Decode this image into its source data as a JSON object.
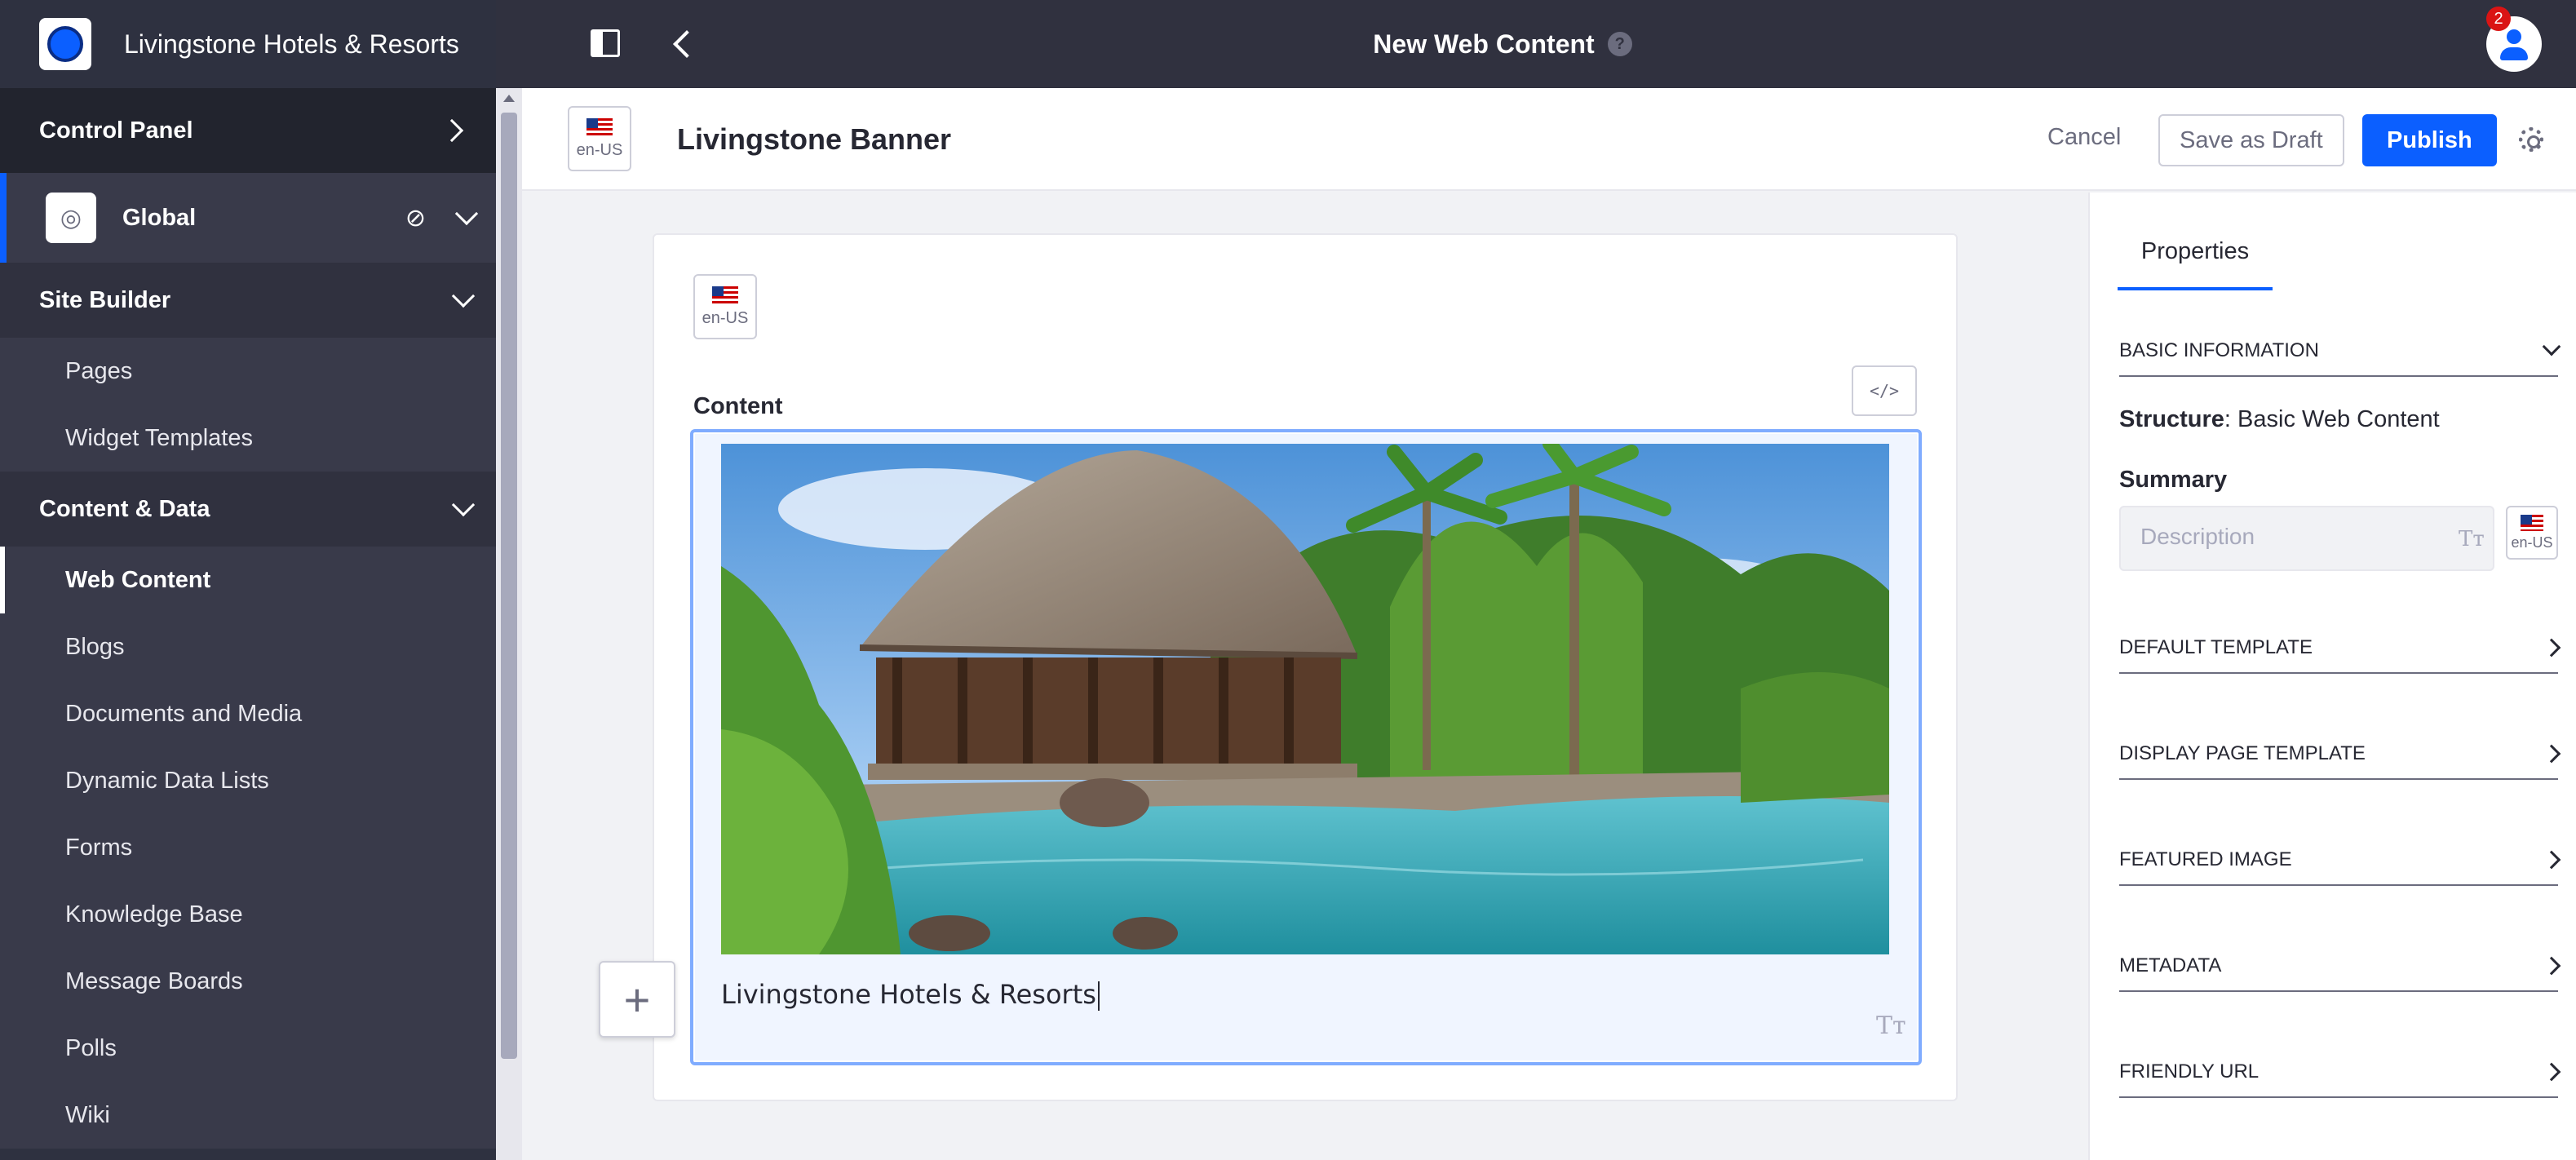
{
  "sidebar": {
    "brand": "Livingstone Hotels & Resorts",
    "control_panel": "Control Panel",
    "scope": "Global",
    "site_builder": {
      "label": "Site Builder",
      "items": [
        "Pages",
        "Widget Templates"
      ]
    },
    "content_data": {
      "label": "Content & Data",
      "items": [
        "Web Content",
        "Blogs",
        "Documents and Media",
        "Dynamic Data Lists",
        "Forms",
        "Knowledge Base",
        "Message Boards",
        "Polls",
        "Wiki"
      ],
      "active": "Web Content"
    }
  },
  "topbar": {
    "title": "New Web Content",
    "help": "?",
    "notifications": "2"
  },
  "editbar": {
    "language": "en-US",
    "title": "Livingstone Banner",
    "cancel": "Cancel",
    "save_draft": "Save as Draft",
    "publish": "Publish"
  },
  "form": {
    "language": "en-US",
    "content_label": "Content",
    "code_toggle": "</>",
    "editor_text": "Livingstone Hotels & Resorts",
    "image_alt": "Tropical resort with thatched roof pavilion and pool",
    "text_format_icon": "Tт"
  },
  "properties": {
    "tab": "Properties",
    "basic_information": "BASIC INFORMATION",
    "structure_label": "Structure",
    "structure_value": ": Basic Web Content",
    "summary_label": "Summary",
    "description_placeholder": "Description",
    "language": "en-US",
    "sections": [
      "DEFAULT TEMPLATE",
      "DISPLAY PAGE TEMPLATE",
      "FEATURED IMAGE",
      "METADATA",
      "FRIENDLY URL"
    ]
  },
  "colors": {
    "accent": "#0b5fff",
    "sidebar": "#2e3140",
    "topbar": "#30313f"
  }
}
